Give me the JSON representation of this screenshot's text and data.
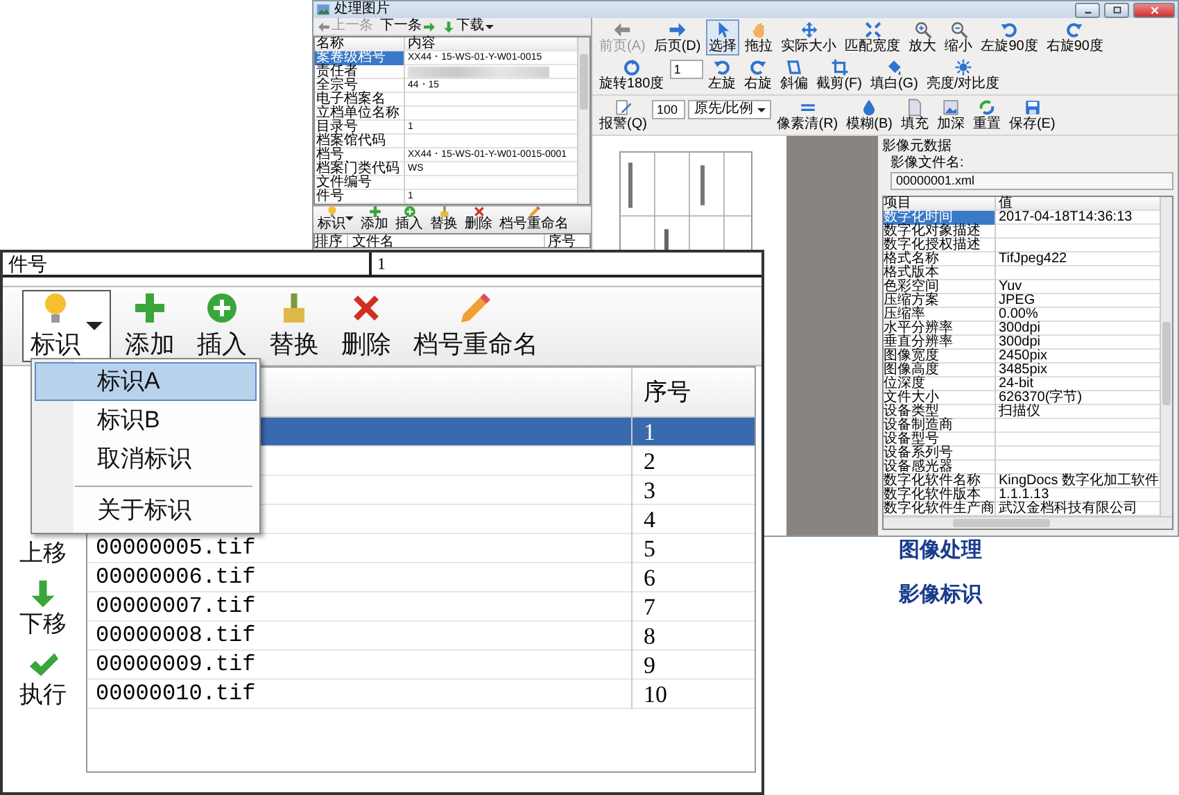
{
  "background_window": {
    "title": "处理图片",
    "nav": [
      {
        "label": "上一条",
        "disabled": true
      },
      {
        "label": "下一条",
        "disabled": false
      },
      {
        "label": "下载",
        "disabled": false
      }
    ],
    "property_grid": {
      "columns": [
        "名称",
        "内容"
      ],
      "rows": [
        {
          "name": "案卷级档号",
          "value": "XX44・15-WS-01-Y-W01-0015",
          "selected": true,
          "redacted": false
        },
        {
          "name": "责任者",
          "selected": false,
          "redacted": true
        },
        {
          "name": "全宗号",
          "value": "44・15",
          "selected": false,
          "redacted": false
        },
        {
          "name": "电子档案名",
          "selected": false,
          "redacted": false
        },
        {
          "name": "立档单位名称",
          "selected": false,
          "redacted": false
        },
        {
          "name": "目录号",
          "value": "1",
          "selected": false,
          "redacted": false
        },
        {
          "name": "档案馆代码",
          "selected": false,
          "redacted": false
        },
        {
          "name": "档号",
          "value": "XX44・15-WS-01-Y-W01-0015-0001",
          "selected": false,
          "redacted": false
        },
        {
          "name": "档案门类代码",
          "value": "WS",
          "selected": false,
          "redacted": false
        },
        {
          "name": "文件编号",
          "selected": false,
          "redacted": false
        },
        {
          "name": "件号",
          "value": "1",
          "selected": false,
          "redacted": false
        }
      ]
    },
    "file_toolbar": [
      {
        "label": "标识",
        "kind": "dropdown"
      },
      {
        "label": "添加",
        "kind": "button"
      },
      {
        "label": "插入",
        "kind": "button"
      },
      {
        "label": "替换",
        "kind": "button"
      },
      {
        "label": "删除",
        "kind": "button"
      },
      {
        "label": "档号重命名",
        "kind": "button"
      }
    ],
    "file_list": {
      "columns": [
        "排序",
        "文件名",
        "序号"
      ]
    },
    "viewer_toolbar": {
      "row_1": [
        {
          "label": "前页(A)",
          "kind": "button",
          "disabled": true,
          "selected": false
        },
        {
          "label": "后页(D)",
          "kind": "button",
          "disabled": false,
          "selected": false
        },
        {
          "label": "选择",
          "kind": "button",
          "disabled": false,
          "selected": true
        },
        {
          "label": "拖拉",
          "kind": "button",
          "disabled": false,
          "selected": false
        },
        {
          "label": "实际大小",
          "kind": "button",
          "disabled": false,
          "selected": false
        },
        {
          "label": "匹配宽度",
          "kind": "button",
          "disabled": false,
          "selected": false
        },
        {
          "label": "放大",
          "kind": "button",
          "disabled": false,
          "selected": false
        },
        {
          "label": "缩小",
          "kind": "button",
          "disabled": false,
          "selected": false
        },
        {
          "label": "左旋90度",
          "kind": "button",
          "disabled": false,
          "selected": false
        },
        {
          "label": "右旋90度",
          "kind": "button",
          "disabled": false,
          "selected": false
        },
        {
          "label": "旋转180度",
          "kind": "button",
          "disabled": false,
          "selected": false
        },
        {
          "kind": "field",
          "value": "1"
        },
        {
          "label": "左旋",
          "kind": "button",
          "disabled": false,
          "selected": false
        },
        {
          "label": "右旋",
          "kind": "button",
          "disabled": false,
          "selected": false
        },
        {
          "label": "斜偏",
          "kind": "button",
          "disabled": false,
          "selected": false
        },
        {
          "label": "截剪(F)",
          "kind": "button",
          "disabled": false,
          "selected": false
        },
        {
          "label": "填白(G)",
          "kind": "button",
          "disabled": false,
          "selected": false
        },
        {
          "label": "亮度/对比度",
          "kind": "button",
          "disabled": false,
          "selected": false
        }
      ],
      "row_2": [
        {
          "label": "报警(Q)",
          "kind": "button",
          "disabled": false,
          "selected": false
        },
        {
          "kind": "field",
          "value": "100"
        },
        {
          "kind": "select",
          "value": "原先/比例"
        },
        {
          "label": "像素清(R)",
          "kind": "button",
          "disabled": false,
          "selected": false
        },
        {
          "label": "模糊(B)",
          "kind": "button",
          "disabled": false,
          "selected": false
        },
        {
          "label": "填充",
          "kind": "button",
          "disabled": false,
          "selected": false
        },
        {
          "label": "加深",
          "kind": "button",
          "disabled": false,
          "selected": false
        },
        {
          "label": "重置",
          "kind": "button",
          "disabled": false,
          "selected": false
        },
        {
          "label": "保存(E)",
          "kind": "button",
          "disabled": false,
          "selected": false
        }
      ]
    },
    "metadata": {
      "title": "影像元数据",
      "file_label": "影像文件名:",
      "file_name": "00000001.xml",
      "columns": [
        "项目",
        "值"
      ],
      "rows": [
        {
          "name": "数字化时间",
          "value": "2017-04-18T14:36:13",
          "selected": true
        },
        {
          "name": "数字化对象描述",
          "selected": false
        },
        {
          "name": "数字化授权描述",
          "selected": false
        },
        {
          "name": "格式名称",
          "value": "TifJpeg422",
          "selected": false
        },
        {
          "name": "格式版本",
          "selected": false
        },
        {
          "name": "色彩空间",
          "value": "Yuv",
          "selected": false
        },
        {
          "name": "压缩方案",
          "value": "JPEG",
          "selected": false
        },
        {
          "name": "压缩率",
          "value": "0.00%",
          "selected": false
        },
        {
          "name": "水平分辨率",
          "value": "300dpi",
          "selected": false
        },
        {
          "name": "垂直分辨率",
          "value": "300dpi",
          "selected": false
        },
        {
          "name": "图像宽度",
          "value": "2450pix",
          "selected": false
        },
        {
          "name": "图像高度",
          "value": "3485pix",
          "selected": false
        },
        {
          "name": "位深度",
          "value": "24-bit",
          "selected": false
        },
        {
          "name": "文件大小",
          "value": "626370(字节)",
          "selected": false
        },
        {
          "name": "设备类型",
          "value": "扫描仪",
          "selected": false
        },
        {
          "name": "设备制造商",
          "selected": false
        },
        {
          "name": "设备型号",
          "selected": false
        },
        {
          "name": "设备系列号",
          "selected": false
        },
        {
          "name": "设备感光器",
          "selected": false
        },
        {
          "name": "数字化软件名称",
          "value": "KingDocs 数字化加工软件",
          "selected": false
        },
        {
          "name": "数字化软件版本",
          "value": "1.1.1.13",
          "selected": false
        },
        {
          "name": "数字化软件生产商",
          "value": "武汉金档科技有限公司",
          "selected": false
        }
      ]
    }
  },
  "file_panel": {
    "top_row": {
      "label": "件号",
      "value": "1"
    },
    "toolbar": [
      {
        "label": "标识",
        "kind": "dropdown",
        "expanded": true
      },
      {
        "label": "添加",
        "kind": "button",
        "expanded": false
      },
      {
        "label": "插入",
        "kind": "button",
        "expanded": false
      },
      {
        "label": "替换",
        "kind": "button",
        "expanded": false
      },
      {
        "label": "删除",
        "kind": "button",
        "expanded": false
      },
      {
        "label": "档号重命名",
        "kind": "button",
        "expanded": false
      }
    ],
    "menu": [
      {
        "label": "标识A",
        "selected": true,
        "separator_before": false
      },
      {
        "label": "标识B",
        "selected": false,
        "separator_before": false
      },
      {
        "label": "取消标识",
        "selected": false,
        "separator_before": false
      },
      {
        "label": "关于标识",
        "selected": false,
        "separator_before": true
      }
    ],
    "side_buttons": [
      "上移",
      "下移",
      "执行"
    ],
    "grid": {
      "column_2": "序号",
      "rows": [
        {
          "number": "1",
          "selected": true
        },
        {
          "number": "2",
          "selected": false
        },
        {
          "number": "3",
          "selected": false
        },
        {
          "number": "4",
          "selected": false
        },
        {
          "file_name": "00000005.tif",
          "number": "5",
          "selected": false
        },
        {
          "file_name": "00000006.tif",
          "number": "6",
          "selected": false
        },
        {
          "file_name": "00000007.tif",
          "number": "7",
          "selected": false
        },
        {
          "file_name": "00000008.tif",
          "number": "8",
          "selected": false
        },
        {
          "file_name": "00000009.tif",
          "number": "9",
          "selected": false
        },
        {
          "file_name": "00000010.tif",
          "number": "10",
          "selected": false
        }
      ]
    }
  },
  "captions": [
    "图像处理",
    "影像标识"
  ]
}
